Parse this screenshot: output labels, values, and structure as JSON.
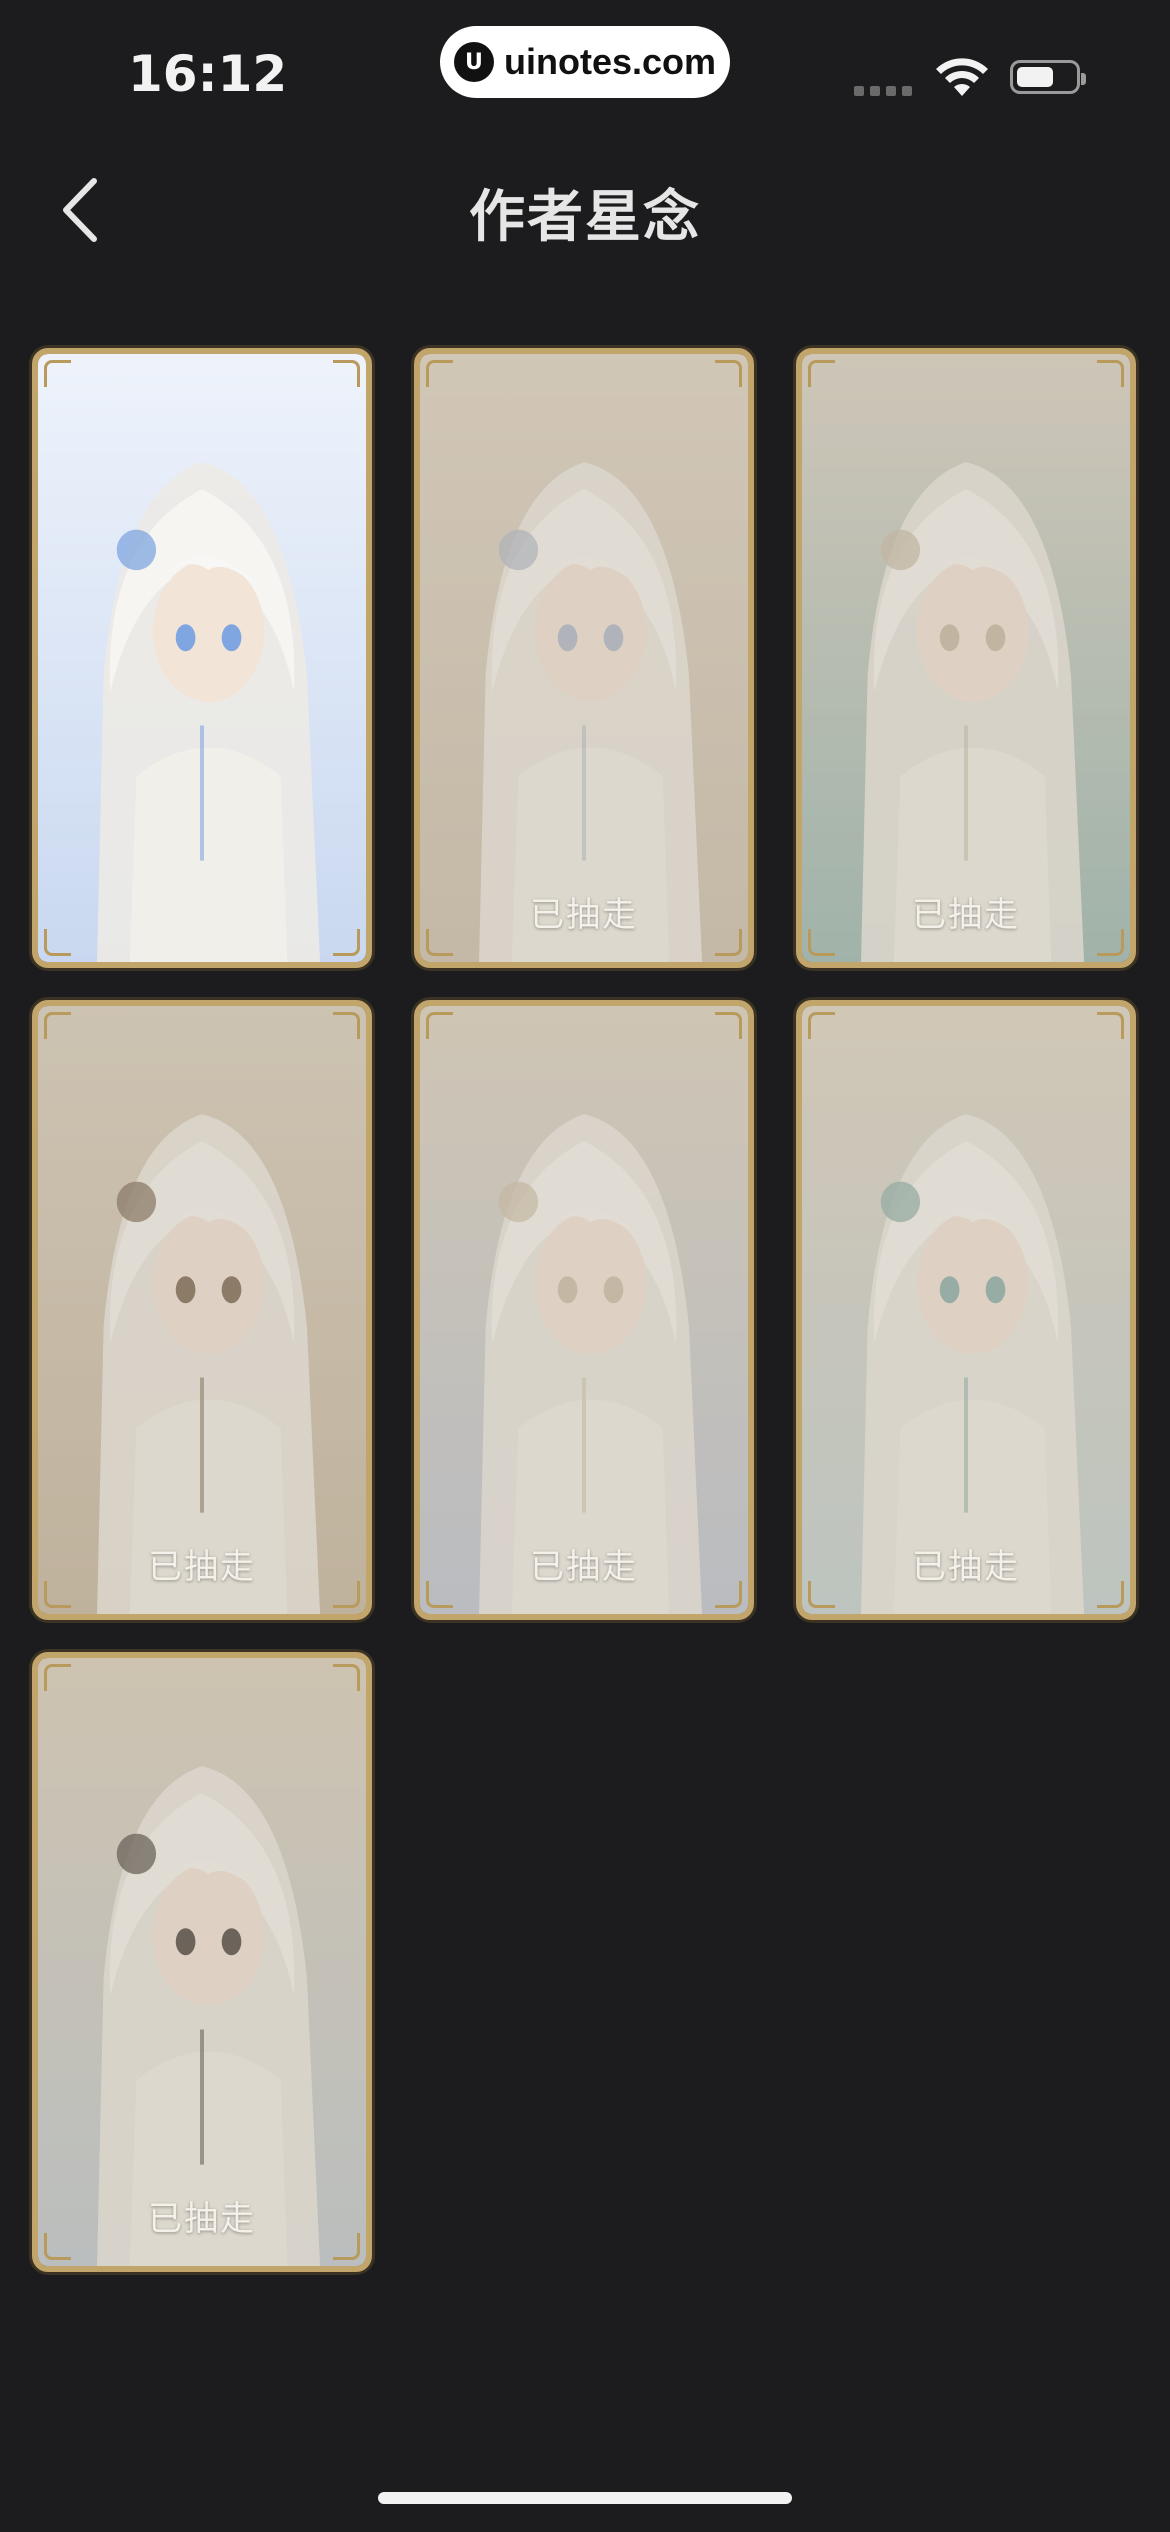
{
  "status_bar": {
    "time": "16:12",
    "site_badge": "uinotes.com",
    "site_logo": "U"
  },
  "nav": {
    "back_icon": "chevron-left-icon",
    "title": "作者星念"
  },
  "cards": [
    {
      "state": "available",
      "label": "",
      "palette": [
        "#eef3fb",
        "#c9d8f0",
        "#7fa6e0"
      ]
    },
    {
      "state": "taken",
      "label": "已抽走",
      "palette": [
        "#ddd3c4",
        "#c8bcaa",
        "#a9b4c8"
      ]
    },
    {
      "state": "taken",
      "label": "已抽走",
      "palette": [
        "#d8d2c6",
        "#8fb3b0",
        "#c4b7a4"
      ]
    },
    {
      "state": "taken",
      "label": "已抽走",
      "palette": [
        "#d7cdbd",
        "#c1b29b",
        "#6e5a45"
      ]
    },
    {
      "state": "taken",
      "label": "已抽走",
      "palette": [
        "#d9d0c0",
        "#b8c2d4",
        "#c9bca7"
      ]
    },
    {
      "state": "taken",
      "label": "已抽走",
      "palette": [
        "#dcd3c4",
        "#bdcfd2",
        "#7fa8a6"
      ]
    },
    {
      "state": "taken",
      "label": "已抽走",
      "palette": [
        "#d8cdbb",
        "#b9c6d0",
        "#3a3430"
      ]
    }
  ],
  "colors": {
    "background": "#1c1c1e",
    "card_border": "#c2a56b",
    "text": "#e6e6e6"
  }
}
